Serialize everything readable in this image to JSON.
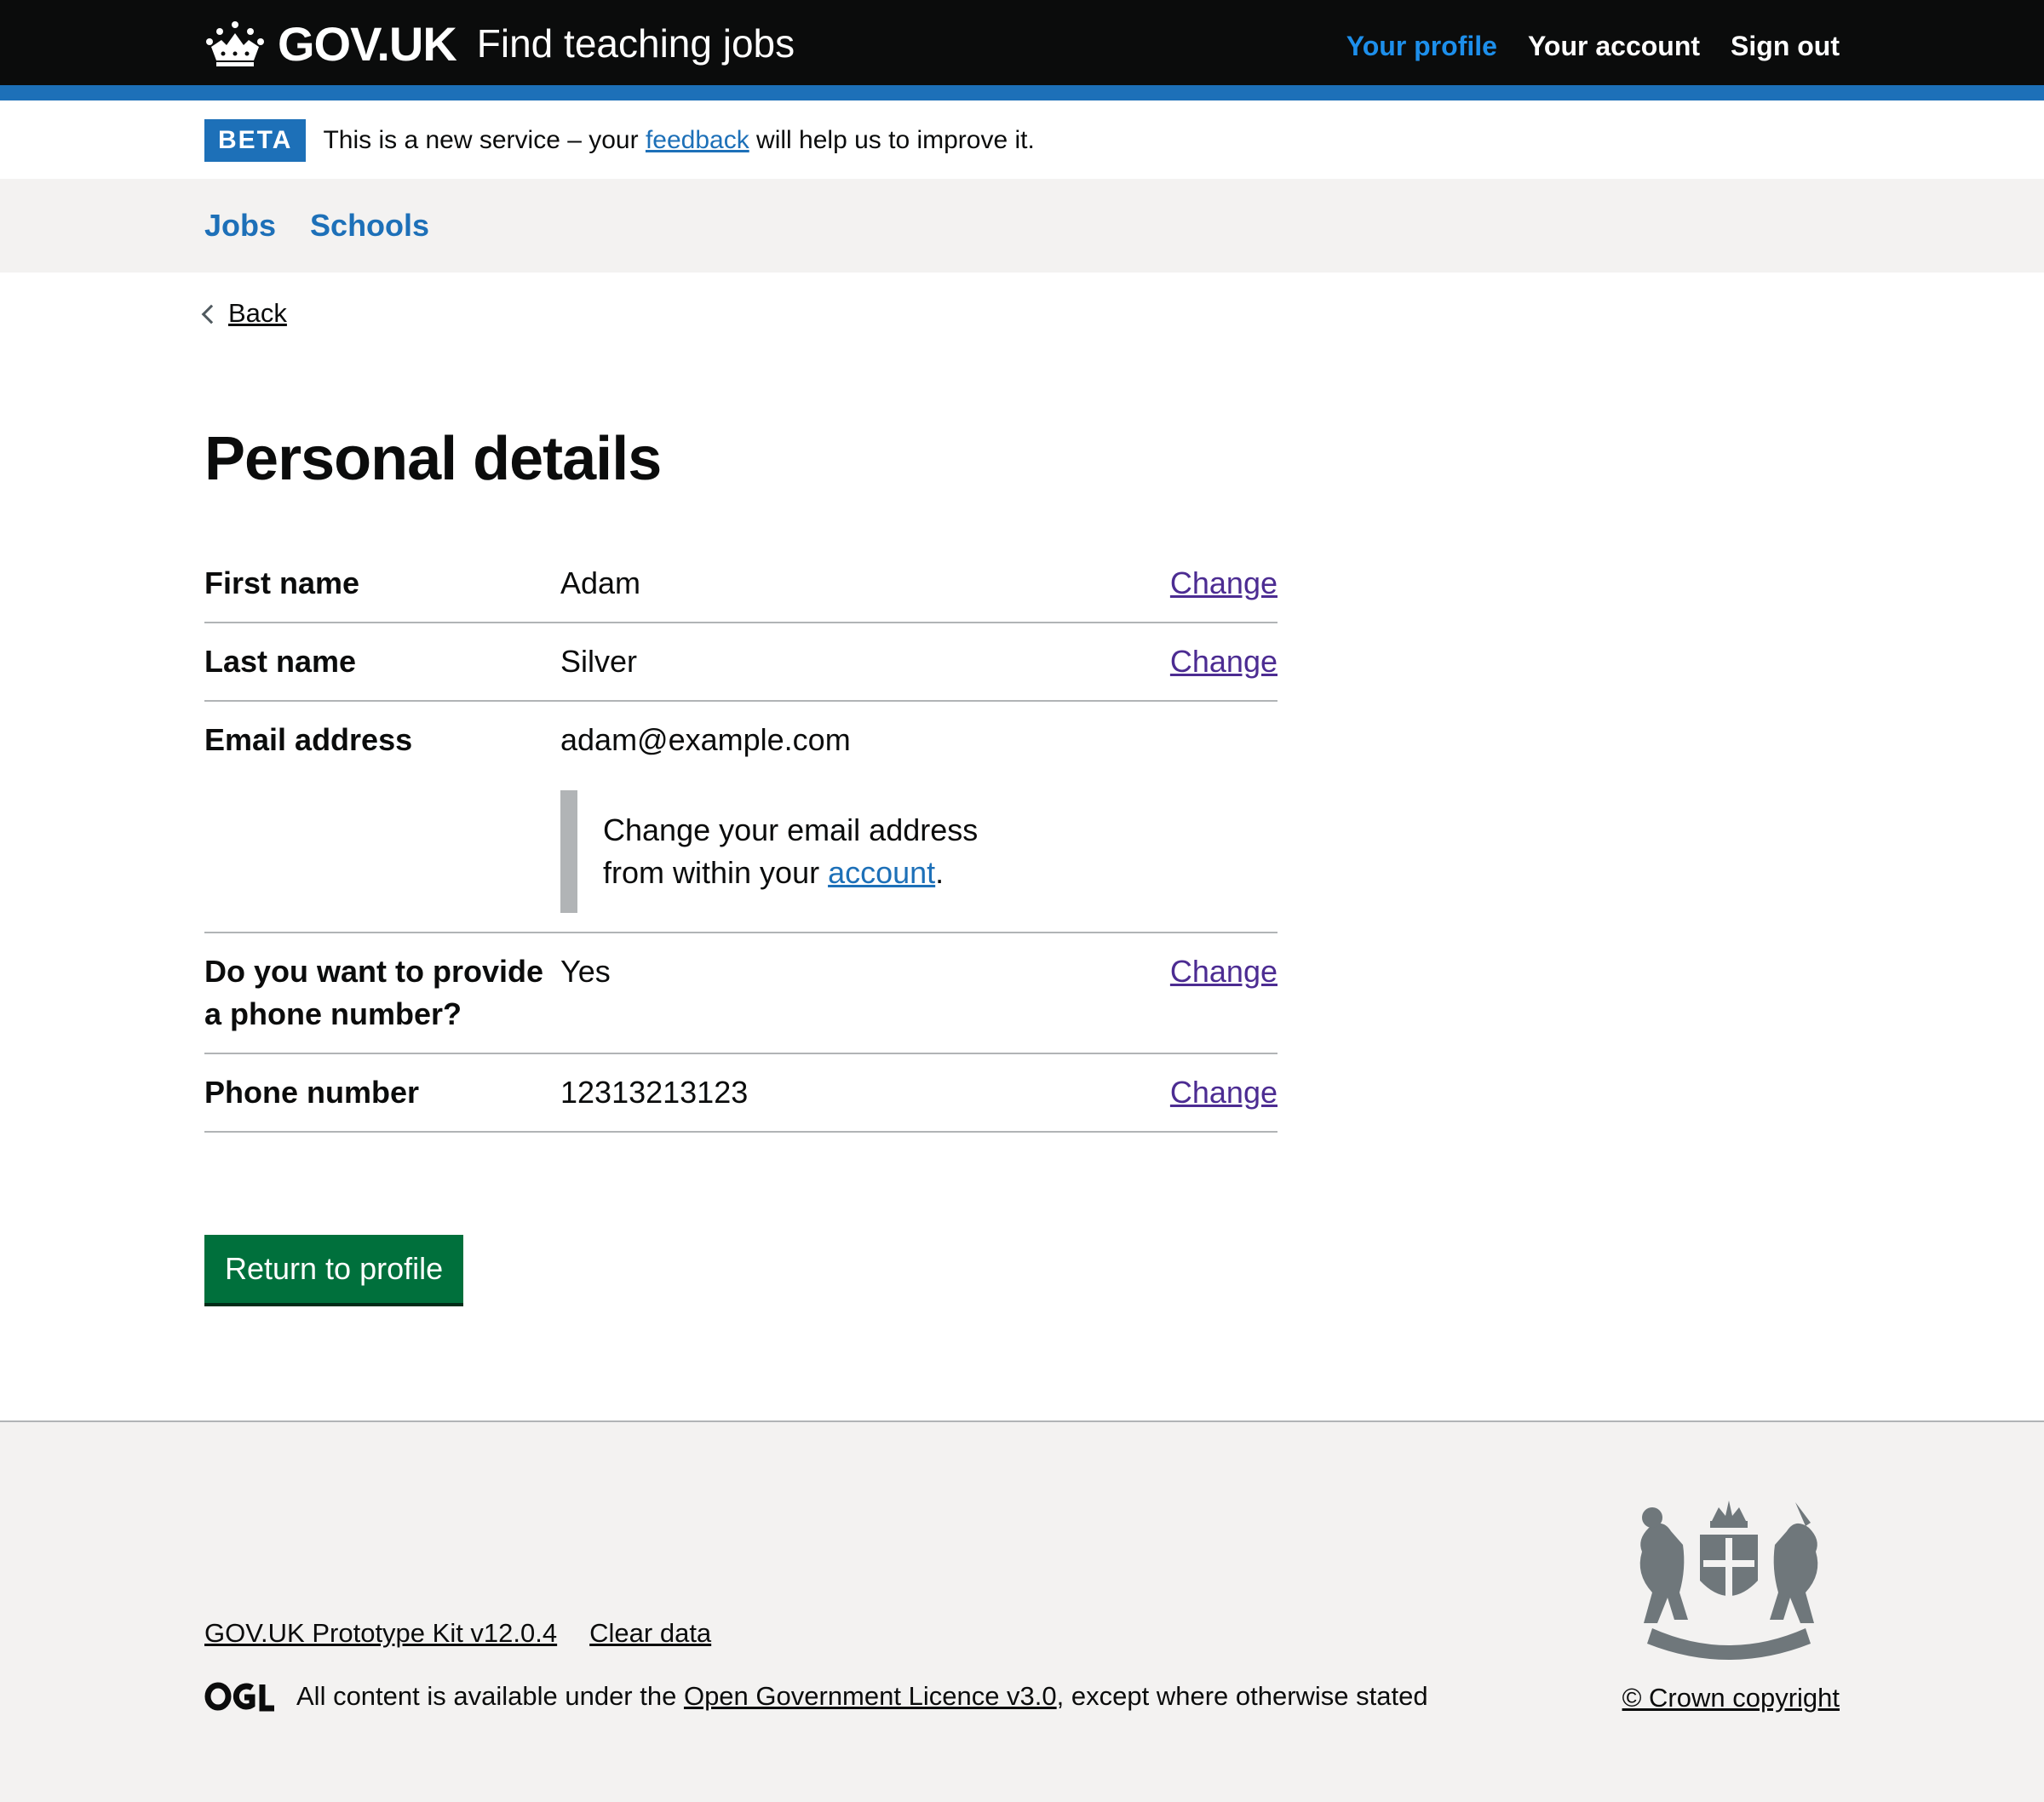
{
  "header": {
    "brand": "GOV.UK",
    "service_name": "Find teaching jobs",
    "nav": [
      "Your profile",
      "Your account",
      "Sign out"
    ]
  },
  "beta": {
    "tag": "BETA",
    "text_before": "This is a new service – your ",
    "link": "feedback",
    "text_after": " will help us to improve it."
  },
  "subnav": [
    "Jobs",
    "Schools"
  ],
  "back_label": "Back",
  "page_title": "Personal details",
  "summary": {
    "rows": [
      {
        "key": "First name",
        "value": "Adam",
        "action": "Change"
      },
      {
        "key": "Last name",
        "value": "Silver",
        "action": "Change"
      },
      {
        "key": "Email address",
        "value": "adam@example.com"
      },
      {
        "key": "Do you want to provide a phone number?",
        "value": "Yes",
        "action": "Change"
      },
      {
        "key": "Phone number",
        "value": "12313213123",
        "action": "Change"
      }
    ],
    "email_inset": {
      "line1": "Change your email address",
      "line2_before": "from within your ",
      "link": "account",
      "line2_after": "."
    }
  },
  "button_label": "Return to profile",
  "footer": {
    "links": [
      "GOV.UK Prototype Kit v12.0.4",
      "Clear data"
    ],
    "licence_before": "All content is available under the ",
    "licence_link": "Open Government Licence v3.0",
    "licence_after": ", except where otherwise stated",
    "copyright": "© Crown copyright"
  }
}
